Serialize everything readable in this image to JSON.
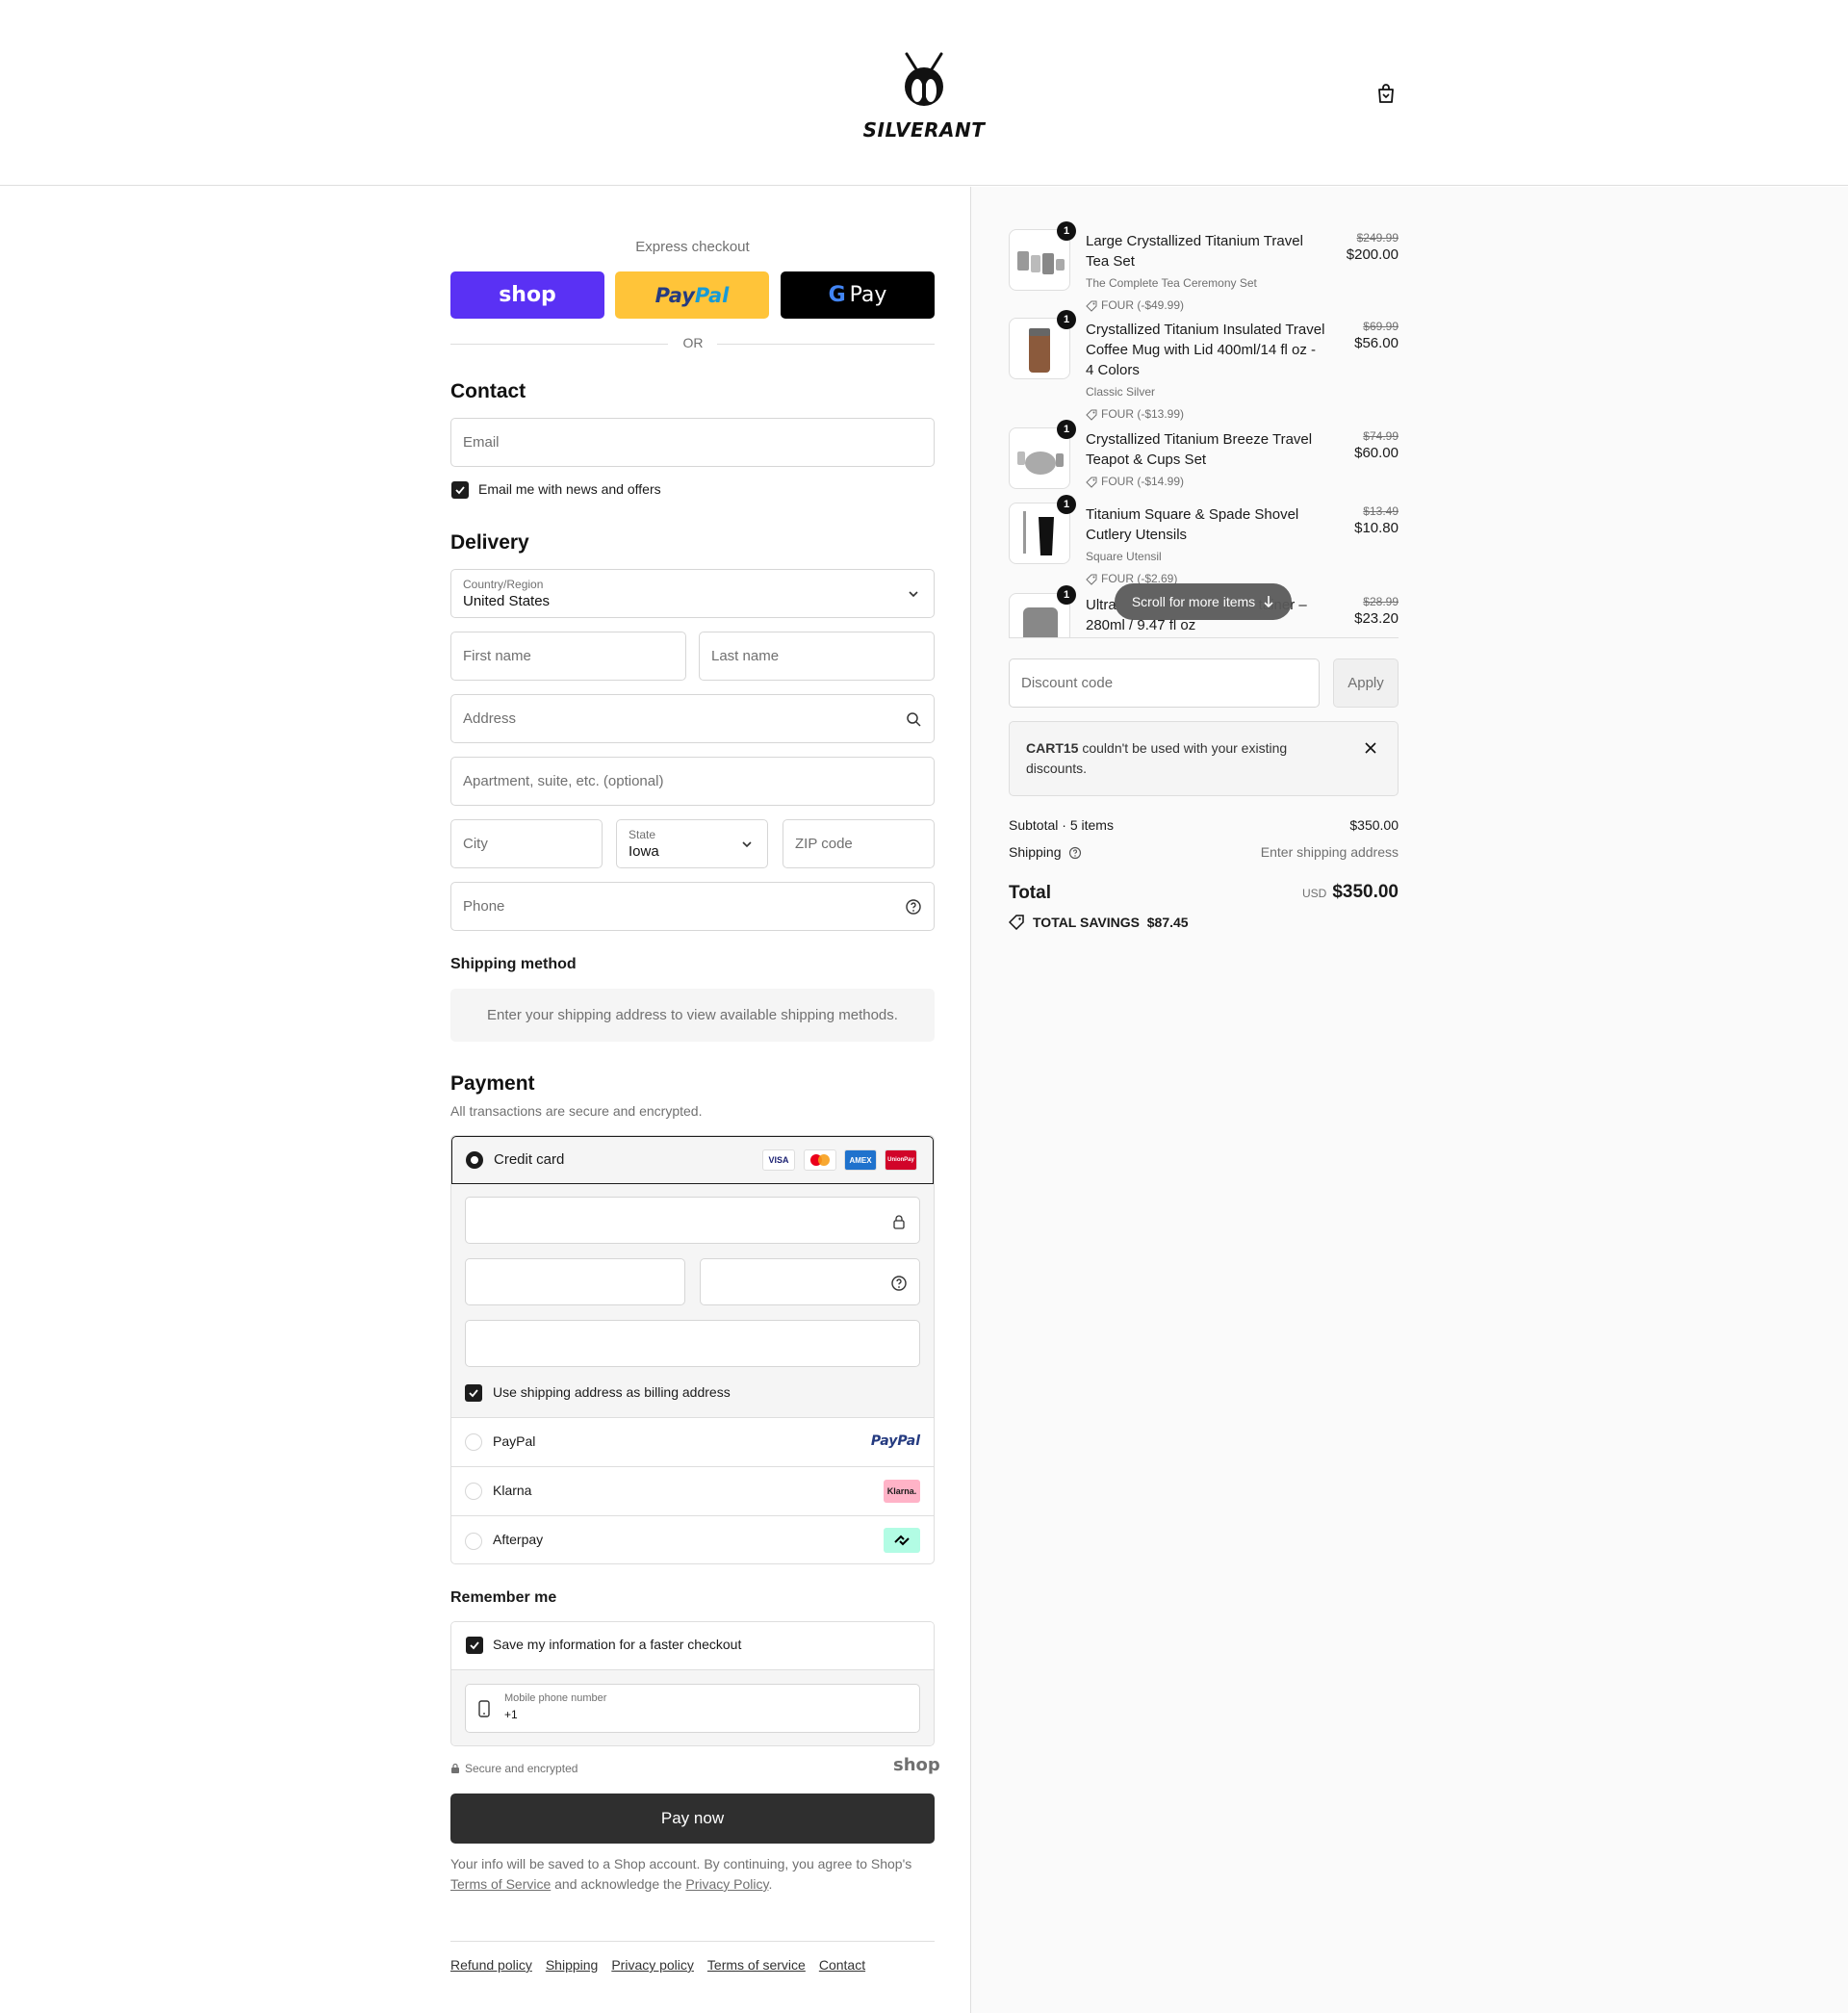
{
  "header": {
    "brand": "SILVERANT",
    "cart_icon": "shopping-bag-icon"
  },
  "express": {
    "title": "Express checkout",
    "shop_label": "shop",
    "paypal_label_a": "Pay",
    "paypal_label_b": "Pal",
    "gpay_label": "Pay",
    "or": "OR",
    "colors": {
      "shop": "#5a31f4",
      "paypal": "#ffc439",
      "gpay": "#000000"
    }
  },
  "contact": {
    "title": "Contact",
    "email_placeholder": "Email",
    "news_label": "Email me with news and offers"
  },
  "delivery": {
    "title": "Delivery",
    "country_label": "Country/Region",
    "country_value": "United States",
    "first_name": "First name",
    "last_name": "Last name",
    "address": "Address",
    "apartment": "Apartment, suite, etc. (optional)",
    "city": "City",
    "state_label": "State",
    "state_value": "Iowa",
    "zip": "ZIP code",
    "phone": "Phone"
  },
  "shipping": {
    "title": "Shipping method",
    "message": "Enter your shipping address to view available shipping methods."
  },
  "payment": {
    "title": "Payment",
    "subtitle": "All transactions are secure and encrypted.",
    "credit_card": "Credit card",
    "card_logos": [
      "VISA",
      "MC",
      "AMEX",
      "UnionPay"
    ],
    "billing_same": "Use shipping address as billing address",
    "paypal": "PayPal",
    "paypal_logo": "PayPal",
    "klarna": "Klarna",
    "klarna_logo": "Klarna.",
    "afterpay": "Afterpay"
  },
  "remember": {
    "title": "Remember me",
    "save_label": "Save my information for a faster checkout",
    "mobile_label": "Mobile phone number",
    "mobile_value": "+1",
    "secure": "Secure and encrypted",
    "shop_logo": "shop"
  },
  "pay_now": "Pay now",
  "legal": {
    "text_a": "Your info will be saved to a Shop account. By continuing, you agree to Shop's",
    "tos": "Terms of Service",
    "text_b": "and acknowledge the",
    "privacy": "Privacy Policy",
    "text_c": "."
  },
  "footer": [
    "Refund policy",
    "Shipping",
    "Privacy policy",
    "Terms of service",
    "Contact"
  ],
  "summary": {
    "items": [
      {
        "qty": "1",
        "name": "Large Crystallized Titanium Travel Tea Set",
        "variant": "The Complete Tea Ceremony Set",
        "discount": "FOUR (-$49.99)",
        "orig": "$249.99",
        "price": "$200.00"
      },
      {
        "qty": "1",
        "name": "Crystallized Titanium Insulated Travel Coffee Mug with Lid 400ml/14 fl oz - 4 Colors",
        "variant": "Classic Silver",
        "discount": "FOUR (-$13.99)",
        "orig": "$69.99",
        "price": "$56.00"
      },
      {
        "qty": "1",
        "name": "Crystallized Titanium Breeze Travel Teapot & Cups Set",
        "variant": "",
        "discount": "FOUR (-$14.99)",
        "orig": "$74.99",
        "price": "$60.00"
      },
      {
        "qty": "1",
        "name": "Titanium Square & Spade Shovel Cutlery Utensils",
        "variant": "Square Utensil",
        "discount": "FOUR (-$2.69)",
        "orig": "$13.49",
        "price": "$10.80"
      },
      {
        "qty": "1",
        "name_a": "Ultra",
        "name_b": "tainer –",
        "name_c": "280ml / 9.47 fl oz",
        "orig": "$28.99",
        "price": "$23.20"
      }
    ],
    "scroll_hint": "Scroll for more items",
    "discount_placeholder": "Discount code",
    "apply": "Apply",
    "alert_code": "CART15",
    "alert_text": "couldn't be used with your existing discounts.",
    "subtotal_label": "Subtotal · 5 items",
    "subtotal_value": "$350.00",
    "shipping_label": "Shipping",
    "shipping_value": "Enter shipping address",
    "total_label": "Total",
    "currency": "USD",
    "total_value": "$350.00",
    "savings_label": "TOTAL SAVINGS",
    "savings_value": "$87.45"
  }
}
